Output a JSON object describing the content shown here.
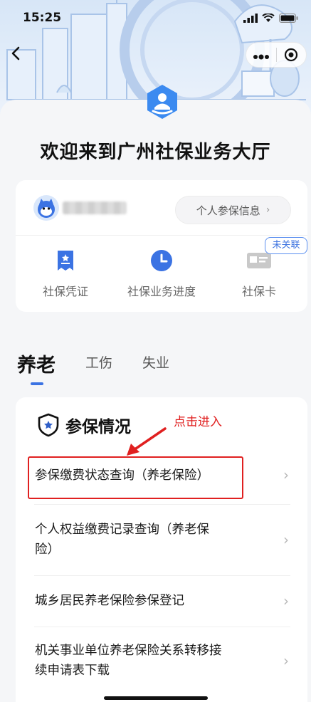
{
  "status_bar": {
    "time": "15:25"
  },
  "page": {
    "welcome_title": "欢迎来到广州社保业务大厅"
  },
  "user_card": {
    "personal_info_button": "个人参保信息",
    "quick_items": [
      {
        "label": "社保凭证",
        "icon": "certificate-icon"
      },
      {
        "label": "社保业务进度",
        "icon": "clock-icon"
      },
      {
        "label": "社保卡",
        "icon": "card-icon"
      }
    ],
    "unlinked_badge": "未关联"
  },
  "tabs": [
    {
      "label": "养老",
      "active": true
    },
    {
      "label": "工伤",
      "active": false
    },
    {
      "label": "失业",
      "active": false
    }
  ],
  "section": {
    "title": "参保情况",
    "annotation": "点击进入",
    "items": [
      {
        "line1": "参保缴费状态查询（养老保险）",
        "line2": ""
      },
      {
        "line1": "个人权益缴费记录查询（养老保",
        "line2": "险）"
      },
      {
        "line1": "城乡居民养老保险参保登记",
        "line2": ""
      },
      {
        "line1": "机关事业单位养老保险关系转移接",
        "line2": "续申请表下载"
      }
    ]
  },
  "colors": {
    "accent": "#3b73e3",
    "annotation": "#e02020"
  }
}
